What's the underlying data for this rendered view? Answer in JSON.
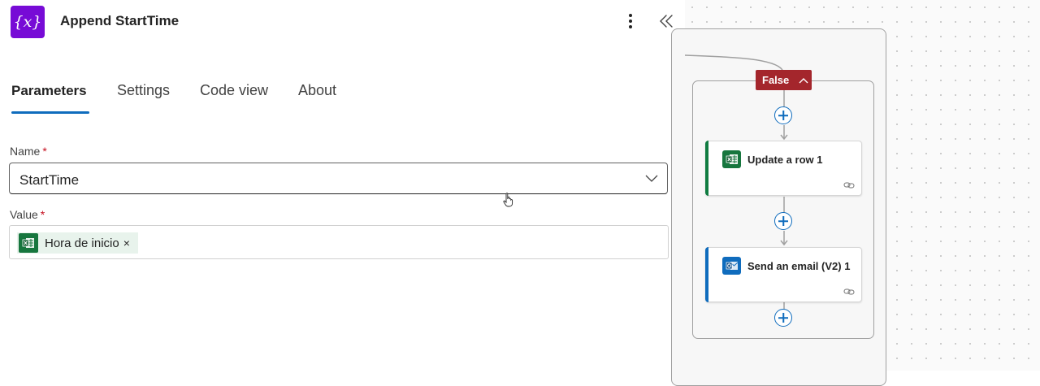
{
  "panel": {
    "icon_glyph": "{x}",
    "title": "Append StartTime",
    "icons": {
      "action": "variable-icon",
      "more": "more-vertical-icon",
      "collapse": "double-chevron-left-icon"
    }
  },
  "tabs": [
    {
      "label": "Parameters",
      "active": true
    },
    {
      "label": "Settings",
      "active": false
    },
    {
      "label": "Code view",
      "active": false
    },
    {
      "label": "About",
      "active": false
    }
  ],
  "fields": {
    "name": {
      "label": "Name",
      "required_mark": "*",
      "value": "StartTime"
    },
    "value": {
      "label": "Value",
      "required_mark": "*",
      "token_label": "Hora de inicio",
      "token_remove": "×"
    }
  },
  "canvas": {
    "branch_label": "False",
    "cards": [
      {
        "label": "Update a row 1",
        "accent": "#107c41",
        "icon": "excel-icon"
      },
      {
        "label": "Send an email (V2) 1",
        "accent": "#0f6cbd",
        "icon": "outlook-icon"
      }
    ]
  },
  "colors": {
    "accent": "#0f6cbd",
    "variable": "#770bd6",
    "excel": "#17763e",
    "false_branch": "#a4262c"
  }
}
